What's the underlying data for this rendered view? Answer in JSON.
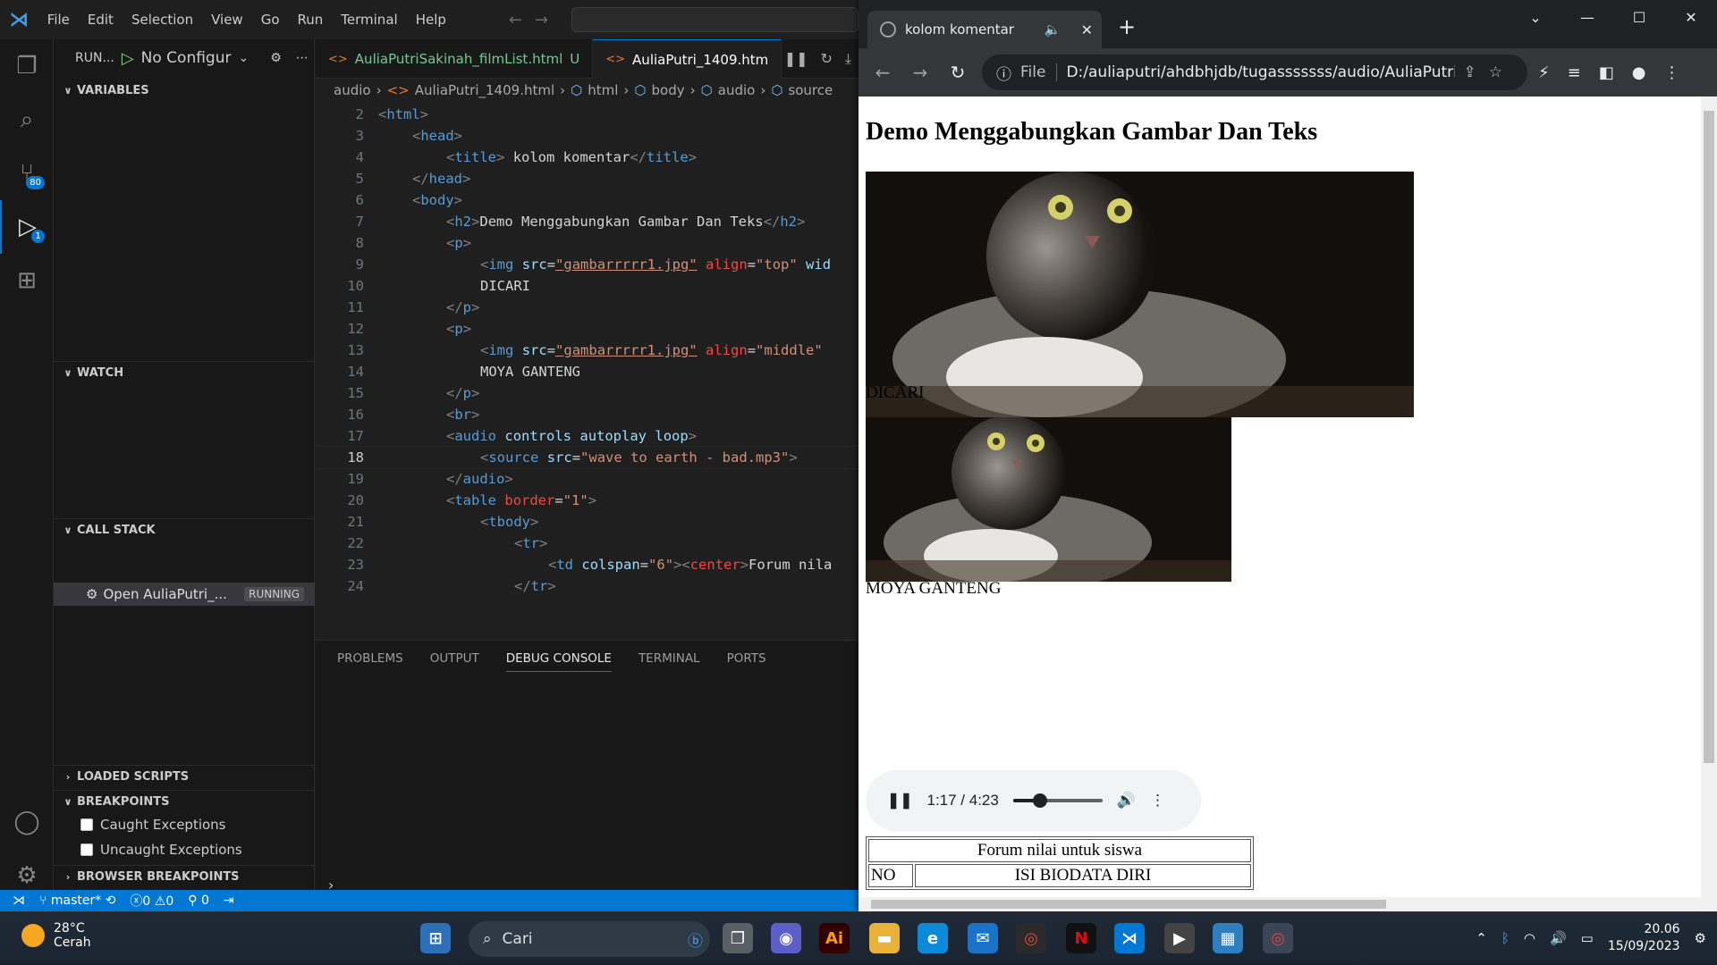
{
  "vscode": {
    "menu": [
      "File",
      "Edit",
      "Selection",
      "View",
      "Go",
      "Run",
      "Terminal",
      "Help"
    ],
    "badges": {
      "source_control": "80",
      "run_debug": "1"
    },
    "sidebar": {
      "run_label": "RUN...",
      "config": "No Configur",
      "variables": "VARIABLES",
      "watch": "WATCH",
      "call_stack": "CALL STACK",
      "stack_item": "Open AuliaPutri_...",
      "stack_status": "RUNNING",
      "loaded_scripts": "LOADED SCRIPTS",
      "breakpoints": "BREAKPOINTS",
      "caught": "Caught Exceptions",
      "uncaught": "Uncaught Exceptions",
      "browser_breakpoints": "BROWSER BREAKPOINTS"
    },
    "tabs": [
      {
        "label": "AuliaPutriSakinah_filmList.html",
        "mod": "U"
      },
      {
        "label": "AuliaPutri_1409.htm"
      }
    ],
    "breadcrumbs": [
      "audio",
      "AuliaPutri_1409.html",
      "html",
      "body",
      "audio",
      "source"
    ],
    "code_lines": {
      "l2": "2",
      "l3": "3",
      "l4": "4",
      "l5": "5",
      "l6": "6",
      "l7": "7",
      "l8": "8",
      "l9": "9",
      "l10": "10",
      "l11": "11",
      "l12": "12",
      "l13": "13",
      "l14": "14",
      "l15": "15",
      "l16": "16",
      "l17": "17",
      "l18": "18",
      "l19": "19",
      "l20": "20",
      "l21": "21",
      "l22": "22",
      "l23": "23",
      "l24": "24"
    },
    "code": {
      "c4_text": " kolom komentar",
      "c7_text": "Demo Menggabungkan Gambar Dan Teks",
      "c9_src": "\"gambarrrrr1.jpg\"",
      "c9_align": "\"top\"",
      "c10_text": "DICARI",
      "c13_src": "\"gambarrrrr1.jpg\"",
      "c13_align": "\"middle\"",
      "c14_text": "MOYA GANTENG",
      "c18_src": "\"wave to earth - bad.mp3\"",
      "c20_border": "\"1\"",
      "c23_colspan": "\"6\"",
      "c23_text": "Forum nila"
    },
    "panel_tabs": [
      "PROBLEMS",
      "OUTPUT",
      "DEBUG CONSOLE",
      "TERMINAL",
      "PORTS"
    ],
    "status": {
      "branch": "master*",
      "errors": "0",
      "warnings": "0",
      "ports": "0"
    }
  },
  "browser": {
    "tab_title": "kolom komentar",
    "url_scheme": "File",
    "url": "D:/auliaputri/ahdbhjdb/tugasssssss/audio/AuliaPutri_1...",
    "page": {
      "heading": "Demo Menggabungkan Gambar Dan Teks",
      "caption1": "DICARI",
      "caption2": "MOYA GANTENG",
      "audio_time": "1:17 / 4:23",
      "audio_progress": 0.3,
      "table_header": "Forum nilai untuk siswa",
      "col_no": "NO",
      "col_isi": "ISI BIODATA DIRI"
    }
  },
  "taskbar": {
    "weather_temp": "28°C",
    "weather_desc": "Cerah",
    "search": "Cari",
    "time": "20.06",
    "date": "15/09/2023"
  }
}
